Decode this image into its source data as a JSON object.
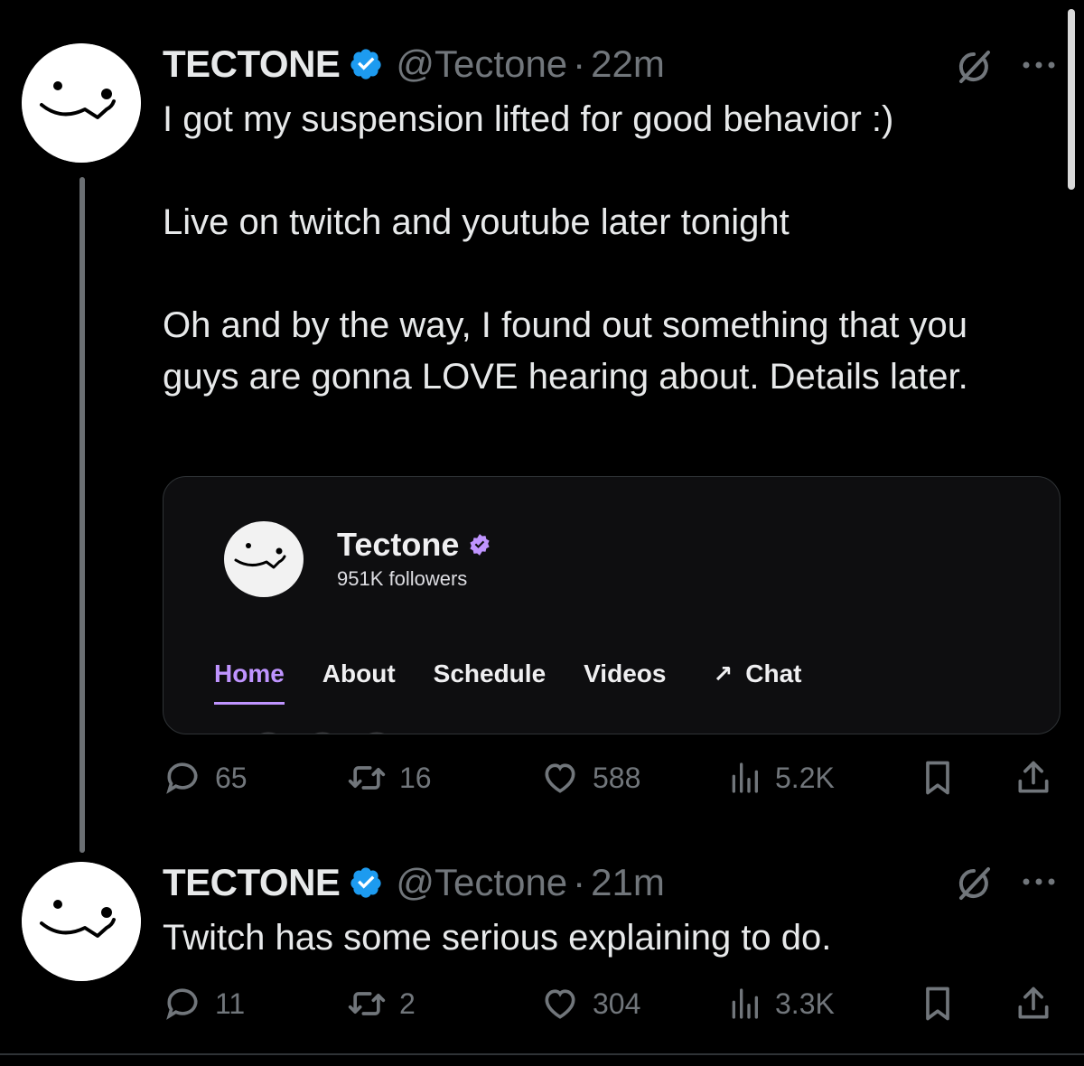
{
  "tweets": [
    {
      "name": "TECTONE",
      "handle": "@Tectone",
      "separator": "·",
      "time": "22m",
      "paragraphs": [
        "I got my suspension lifted for good behavior :)",
        "Live on twitch and youtube later tonight",
        "Oh and by the way, I found out something that you guys are gonna LOVE hearing about. Details later."
      ],
      "card": {
        "channel_name": "Tectone",
        "followers": "951K followers",
        "tabs": [
          "Home",
          "About",
          "Schedule",
          "Videos",
          "Chat"
        ],
        "chat_arrow": "↗"
      },
      "stats": {
        "replies": "65",
        "retweets": "16",
        "likes": "588",
        "views": "5.2K"
      }
    },
    {
      "name": "TECTONE",
      "handle": "@Tectone",
      "separator": "·",
      "time": "21m",
      "text": "Twitch has some serious explaining to do.",
      "stats": {
        "replies": "11",
        "retweets": "2",
        "likes": "304",
        "views": "3.3K"
      }
    }
  ],
  "colors": {
    "background": "#000000",
    "text": "#e7e9ea",
    "muted": "#71767b",
    "verified": "#1d9bf0",
    "twitch_purple": "#bf94ff"
  },
  "icons": [
    "verified-badge-icon",
    "grok-icon",
    "more-icon",
    "reply-icon",
    "retweet-icon",
    "like-icon",
    "views-icon",
    "bookmark-icon",
    "share-icon"
  ]
}
